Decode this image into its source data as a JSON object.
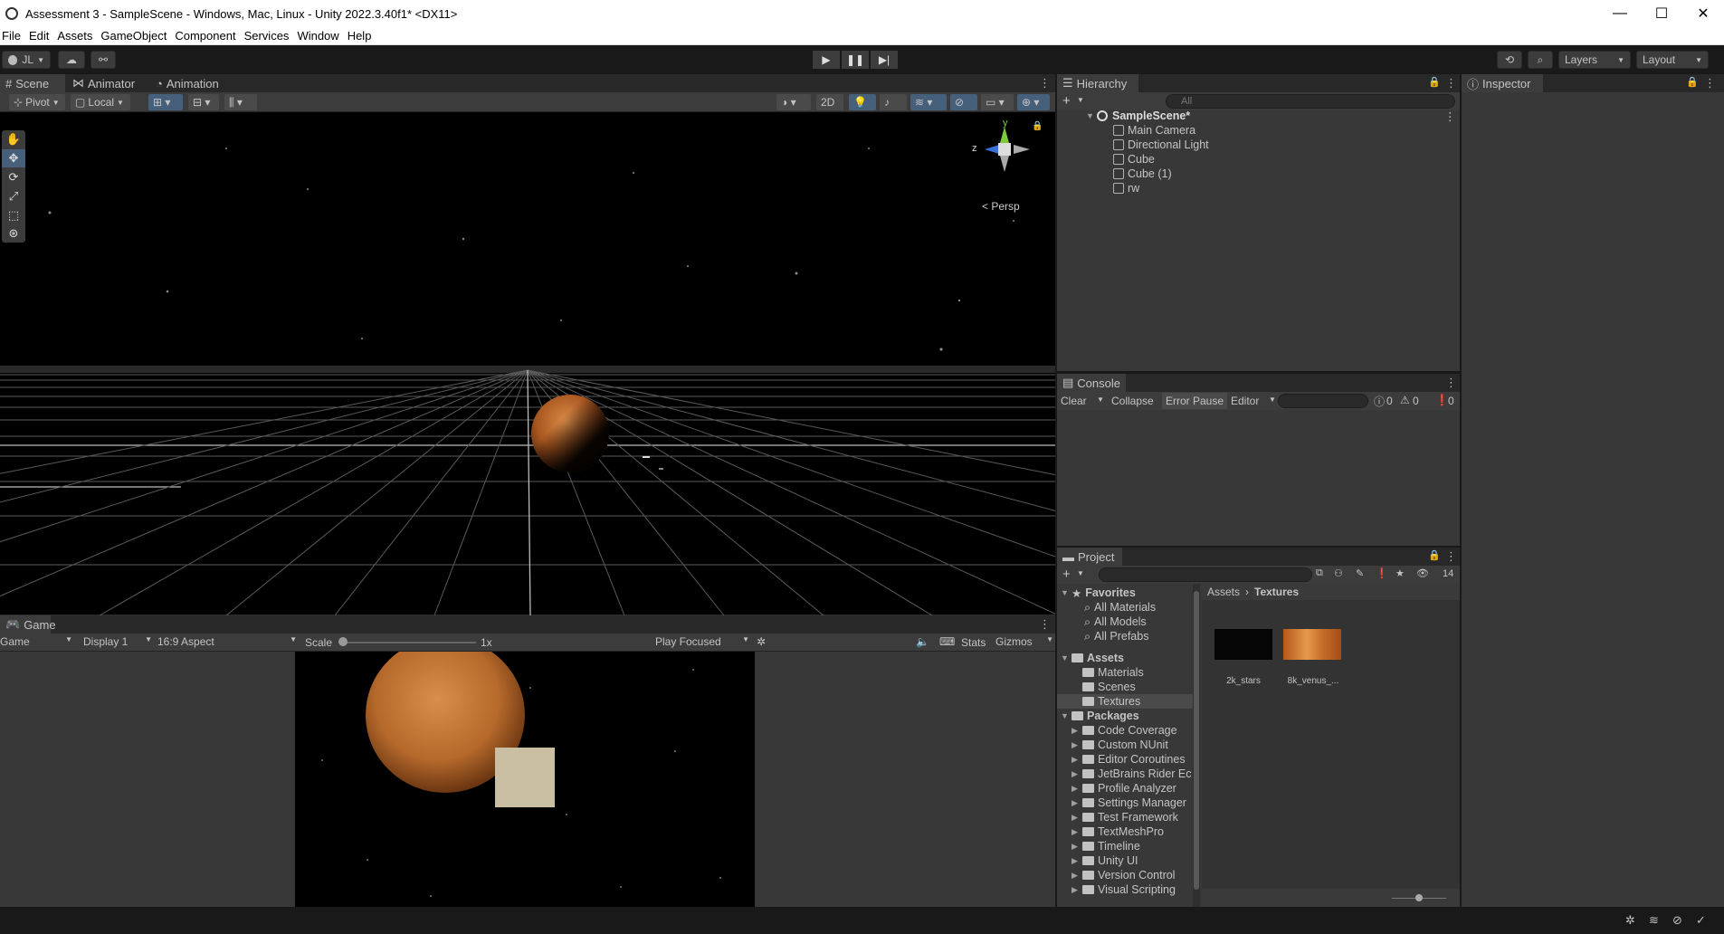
{
  "window": {
    "title": "Assessment 3 - SampleScene - Windows, Mac, Linux - Unity 2022.3.40f1* <DX11>",
    "minimize": "—",
    "maximize": "☐",
    "close": "✕"
  },
  "menu": [
    "File",
    "Edit",
    "Assets",
    "GameObject",
    "Component",
    "Services",
    "Window",
    "Help"
  ],
  "toolbar": {
    "account": "JL",
    "layers": "Layers",
    "layout": "Layout"
  },
  "scene_tabs": {
    "scene": "Scene",
    "animator": "Animator",
    "animation": "Animation"
  },
  "scene_toolbar": {
    "pivot": "Pivot",
    "local": "Local",
    "mode_2d": "2D"
  },
  "gizmo": {
    "y": "y",
    "z": "z",
    "persp": "< Persp"
  },
  "game": {
    "tab": "Game",
    "mode": "Game",
    "display": "Display 1",
    "aspect": "16:9 Aspect",
    "scale_label": "Scale",
    "scale_value": "1x",
    "play_focused": "Play Focused",
    "stats": "Stats",
    "gizmos": "Gizmos"
  },
  "hierarchy": {
    "tab": "Hierarchy",
    "search_placeholder": "All",
    "scene": "SampleScene*",
    "items": [
      "Main Camera",
      "Directional Light",
      "Cube",
      "Cube (1)",
      "rw"
    ]
  },
  "inspector": {
    "tab": "Inspector"
  },
  "console": {
    "tab": "Console",
    "clear": "Clear",
    "collapse": "Collapse",
    "error_pause": "Error Pause",
    "editor": "Editor",
    "count_info": "0",
    "count_warn": "0",
    "count_error": "0"
  },
  "project": {
    "tab": "Project",
    "hidden_count": "14",
    "favorites": "Favorites",
    "fav_items": [
      "All Materials",
      "All Models",
      "All Prefabs"
    ],
    "assets": "Assets",
    "asset_folders": [
      "Materials",
      "Scenes",
      "Textures"
    ],
    "packages": "Packages",
    "package_items": [
      "Code Coverage",
      "Custom NUnit",
      "Editor Coroutines",
      "JetBrains Rider Ec",
      "Profile Analyzer",
      "Settings Manager",
      "Test Framework",
      "TextMeshPro",
      "Timeline",
      "Unity UI",
      "Version Control",
      "Visual Scripting"
    ],
    "breadcrumb_root": "Assets",
    "breadcrumb_current": "Textures",
    "textures": [
      "2k_stars",
      "8k_venus_..."
    ]
  },
  "colors": {
    "accent_blue": "#46607c",
    "panel_bg": "#383838",
    "toolbar_bg": "#191919",
    "venus": "#c07a3a"
  }
}
